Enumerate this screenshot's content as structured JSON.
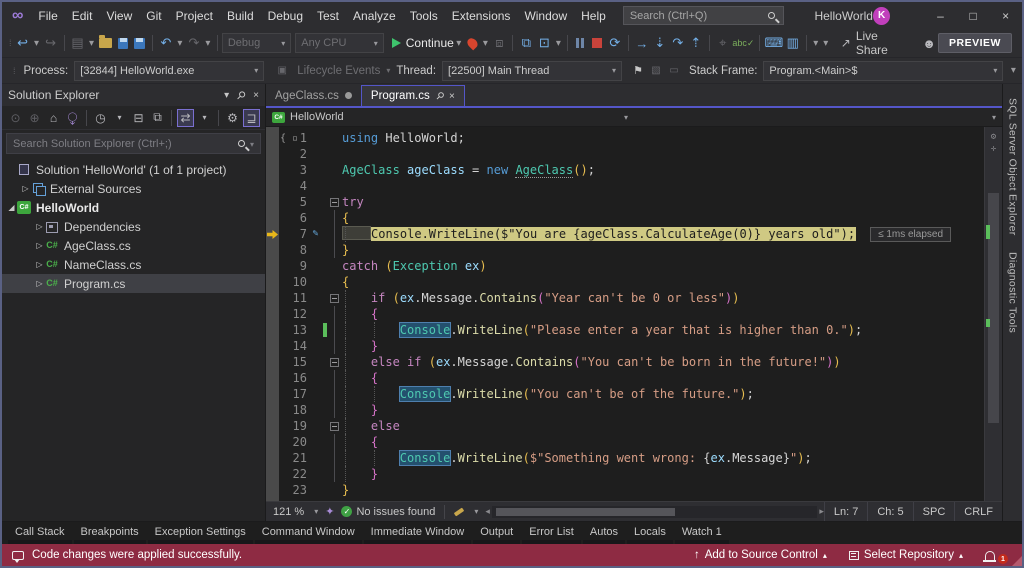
{
  "window": {
    "title": "HelloWorld",
    "avatar_initial": "K"
  },
  "menu": {
    "items": [
      "File",
      "Edit",
      "View",
      "Git",
      "Project",
      "Build",
      "Debug",
      "Test",
      "Analyze",
      "Tools",
      "Extensions",
      "Window",
      "Help"
    ]
  },
  "search": {
    "placeholder": "Search (Ctrl+Q)"
  },
  "toolbar": {
    "configuration": "Debug",
    "platform": "Any CPU",
    "continue_label": "Continue",
    "live_share_label": "Live Share",
    "preview_label": "PREVIEW"
  },
  "debug_bar": {
    "process_label": "Process:",
    "process_value": "[32844] HelloWorld.exe",
    "lifecycle_label": "Lifecycle Events",
    "thread_label": "Thread:",
    "thread_value": "[22500] Main Thread",
    "stack_frame_label": "Stack Frame:",
    "stack_frame_value": "Program.<Main>$"
  },
  "solution_explorer": {
    "title": "Solution Explorer",
    "search_placeholder": "Search Solution Explorer (Ctrl+;)",
    "items": [
      {
        "label": "Solution 'HelloWorld' (1 of 1 project)",
        "icon": "solution",
        "indent": 0,
        "arrow": ""
      },
      {
        "label": "External Sources",
        "icon": "external",
        "indent": 1,
        "arrow": "collapsed"
      },
      {
        "label": "HelloWorld",
        "icon": "project",
        "indent": 0,
        "arrow": "expanded",
        "bold": true
      },
      {
        "label": "Dependencies",
        "icon": "dependencies",
        "indent": 2,
        "arrow": "collapsed"
      },
      {
        "label": "AgeClass.cs",
        "icon": "csfile",
        "indent": 2,
        "arrow": "collapsed"
      },
      {
        "label": "NameClass.cs",
        "icon": "csfile",
        "indent": 2,
        "arrow": "collapsed"
      },
      {
        "label": "Program.cs",
        "icon": "csfile",
        "indent": 2,
        "arrow": "collapsed",
        "selected": true
      }
    ]
  },
  "editor": {
    "tabs": [
      {
        "label": "AgeClass.cs",
        "state": "modified"
      },
      {
        "label": "Program.cs",
        "state": "active"
      }
    ],
    "breadcrumb_project": "HelloWorld",
    "perf_tip": "≤ 1ms elapsed",
    "status": {
      "zoom_level": "121 %",
      "issues_text": "No issues found",
      "line": "Ln: 7",
      "column": "Ch: 5",
      "spaces_label": "SPC",
      "line_ending": "CRLF"
    },
    "code": [
      {
        "n": 1,
        "ind": 0,
        "tok": [
          [
            "using",
            "kw"
          ],
          [
            " HelloWorld;",
            "df"
          ]
        ]
      },
      {
        "n": 2,
        "ind": 0,
        "tok": []
      },
      {
        "n": 3,
        "ind": 0,
        "tok": [
          [
            "AgeClass",
            "type"
          ],
          [
            " ",
            "df"
          ],
          [
            "ageClass",
            "loc"
          ],
          [
            " = ",
            "df"
          ],
          [
            "new",
            "kw"
          ],
          [
            " ",
            "df"
          ],
          [
            "AgeClass",
            "type dot-u"
          ],
          [
            "(",
            "b1"
          ],
          [
            ")",
            "b1"
          ],
          [
            ";",
            "df"
          ]
        ]
      },
      {
        "n": 4,
        "ind": 0,
        "tok": []
      },
      {
        "n": 5,
        "ind": 0,
        "o": "box",
        "tok": [
          [
            "try",
            "ctrl"
          ]
        ]
      },
      {
        "n": 6,
        "ind": 0,
        "o": "line",
        "tok": [
          [
            "{",
            "b1"
          ]
        ]
      },
      {
        "n": 7,
        "ind": 0,
        "o": "line",
        "g": [
          0
        ],
        "cur": true,
        "pen": true,
        "tok": [
          [
            "Console.WriteLine($\"You are {ageClass.CalculateAge(0)} years old\");",
            "dk"
          ]
        ]
      },
      {
        "n": 8,
        "ind": 0,
        "o": "line",
        "tok": [
          [
            "}",
            "b1"
          ]
        ]
      },
      {
        "n": 9,
        "ind": 0,
        "tok": [
          [
            "catch",
            "ctrl"
          ],
          [
            " ",
            "df"
          ],
          [
            "(",
            "b1"
          ],
          [
            "Exception",
            "type"
          ],
          [
            " ",
            "df"
          ],
          [
            "ex",
            "loc"
          ],
          [
            ")",
            "b1"
          ]
        ]
      },
      {
        "n": 10,
        "ind": 0,
        "tok": [
          [
            "{",
            "b1"
          ]
        ]
      },
      {
        "n": 11,
        "ind": 4,
        "o": "box",
        "g": [
          0
        ],
        "tok": [
          [
            "if",
            "ctrl"
          ],
          [
            " ",
            "df"
          ],
          [
            "(",
            "b1"
          ],
          [
            "ex",
            "loc"
          ],
          [
            ".",
            "df"
          ],
          [
            "Message",
            "prop"
          ],
          [
            ".",
            "df"
          ],
          [
            "Contains",
            "meth"
          ],
          [
            "(",
            "b2"
          ],
          [
            "\"Year can't be 0 or less\"",
            "str"
          ],
          [
            ")",
            "b2"
          ],
          [
            ")",
            "b1"
          ]
        ]
      },
      {
        "n": 12,
        "ind": 4,
        "o": "line",
        "g": [
          0
        ],
        "tok": [
          [
            "{",
            "b2"
          ]
        ]
      },
      {
        "n": 13,
        "ind": 8,
        "o": "line",
        "g": [
          0,
          1
        ],
        "chg": true,
        "tok": [
          [
            "Console",
            "type ref"
          ],
          [
            ".",
            "df"
          ],
          [
            "WriteLine",
            "meth"
          ],
          [
            "(",
            "b1"
          ],
          [
            "\"Please enter a year that is higher than 0.\"",
            "str"
          ],
          [
            ")",
            "b1"
          ],
          [
            ";",
            "df"
          ]
        ]
      },
      {
        "n": 14,
        "ind": 4,
        "o": "line",
        "g": [
          0
        ],
        "tok": [
          [
            "}",
            "b2"
          ]
        ]
      },
      {
        "n": 15,
        "ind": 4,
        "o": "box",
        "g": [
          0
        ],
        "tok": [
          [
            "else",
            "ctrl"
          ],
          [
            " ",
            "df"
          ],
          [
            "if",
            "ctrl"
          ],
          [
            " ",
            "df"
          ],
          [
            "(",
            "b1"
          ],
          [
            "ex",
            "loc"
          ],
          [
            ".",
            "df"
          ],
          [
            "Message",
            "prop"
          ],
          [
            ".",
            "df"
          ],
          [
            "Contains",
            "meth"
          ],
          [
            "(",
            "b2"
          ],
          [
            "\"You can't be born in the future!\"",
            "str"
          ],
          [
            ")",
            "b2"
          ],
          [
            ")",
            "b1"
          ]
        ]
      },
      {
        "n": 16,
        "ind": 4,
        "o": "line",
        "g": [
          0
        ],
        "tok": [
          [
            "{",
            "b2"
          ]
        ]
      },
      {
        "n": 17,
        "ind": 8,
        "o": "line",
        "g": [
          0,
          1
        ],
        "tok": [
          [
            "Console",
            "type ref"
          ],
          [
            ".",
            "df"
          ],
          [
            "WriteLine",
            "meth"
          ],
          [
            "(",
            "b1"
          ],
          [
            "\"You can't be of the future.\"",
            "str"
          ],
          [
            ")",
            "b1"
          ],
          [
            ";",
            "df"
          ]
        ]
      },
      {
        "n": 18,
        "ind": 4,
        "o": "line",
        "g": [
          0
        ],
        "tok": [
          [
            "}",
            "b2"
          ]
        ]
      },
      {
        "n": 19,
        "ind": 4,
        "o": "box",
        "g": [
          0
        ],
        "tok": [
          [
            "else",
            "ctrl"
          ]
        ]
      },
      {
        "n": 20,
        "ind": 4,
        "o": "line",
        "g": [
          0
        ],
        "tok": [
          [
            "{",
            "b2"
          ]
        ]
      },
      {
        "n": 21,
        "ind": 8,
        "o": "line",
        "g": [
          0,
          1
        ],
        "tok": [
          [
            "Console",
            "type ref"
          ],
          [
            ".",
            "df"
          ],
          [
            "WriteLine",
            "meth"
          ],
          [
            "(",
            "b1"
          ],
          [
            "$\"Something went wrong: ",
            "str"
          ],
          [
            "{",
            "df"
          ],
          [
            "ex",
            "loc"
          ],
          [
            ".",
            "df"
          ],
          [
            "Message",
            "prop"
          ],
          [
            "}",
            "df"
          ],
          [
            "\"",
            "str"
          ],
          [
            ")",
            "b1"
          ],
          [
            ";",
            "df"
          ]
        ]
      },
      {
        "n": 22,
        "ind": 4,
        "o": "line",
        "g": [
          0
        ],
        "tok": [
          [
            "}",
            "b2"
          ]
        ]
      },
      {
        "n": 23,
        "ind": 0,
        "tok": [
          [
            "}",
            "b1"
          ]
        ]
      }
    ]
  },
  "bottom_panel": {
    "tabs": [
      "Call Stack",
      "Breakpoints",
      "Exception Settings",
      "Command Window",
      "Immediate Window",
      "Output",
      "Error List",
      "Autos",
      "Locals",
      "Watch 1"
    ]
  },
  "status_bar": {
    "message": "Code changes were applied successfully.",
    "source_control_label": "Add to Source Control",
    "repository_label": "Select Repository",
    "notification_count": "1"
  },
  "right_panel": {
    "tabs": [
      "SQL Server Object Explorer",
      "Diagnostic Tools"
    ]
  },
  "colors": {
    "accent": "#5456C8",
    "current_statement_highlight": "#CFC983",
    "status_bar": "#8E2B43"
  }
}
